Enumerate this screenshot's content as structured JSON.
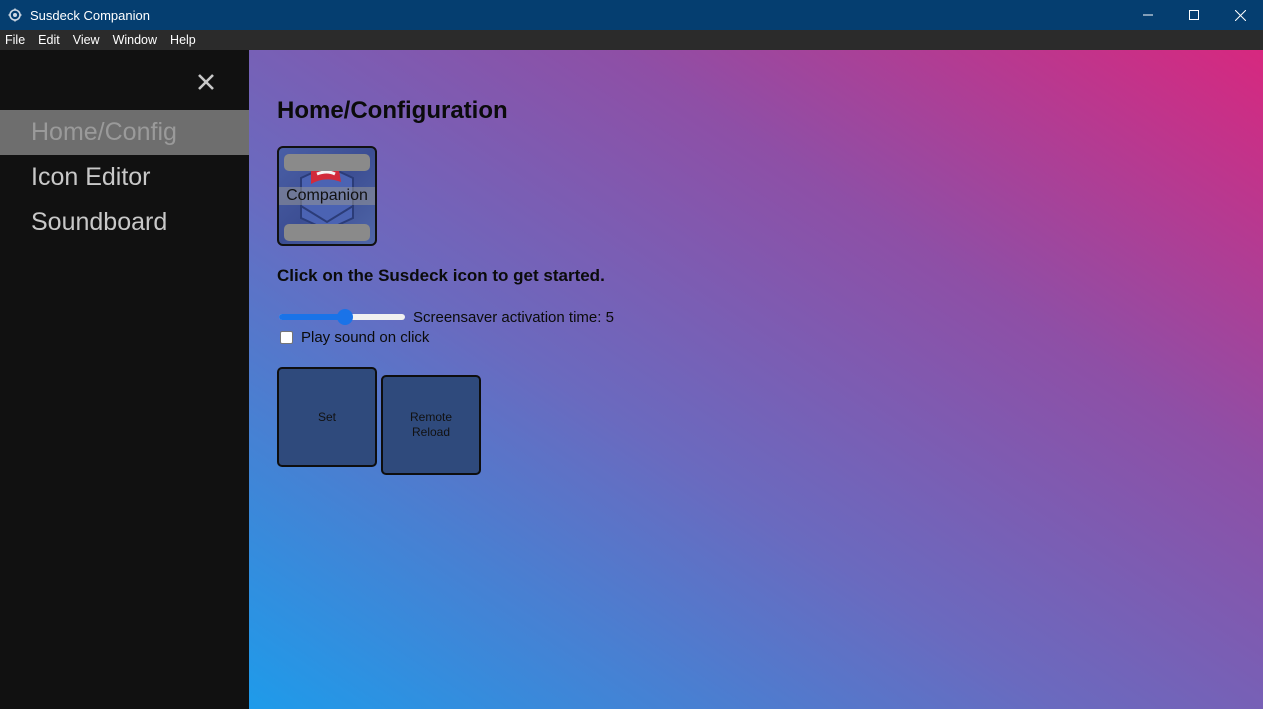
{
  "window": {
    "title": "Susdeck Companion",
    "controls": {
      "minimize": "—",
      "maximize": "☐",
      "close": "✕"
    }
  },
  "menu": [
    "File",
    "Edit",
    "View",
    "Window",
    "Help"
  ],
  "sidebar": {
    "close_symbol": "✕",
    "items": [
      {
        "label": "Home/Config",
        "active": true
      },
      {
        "label": "Icon Editor",
        "active": false
      },
      {
        "label": "Soundboard",
        "active": false
      }
    ]
  },
  "main": {
    "title": "Home/Configuration",
    "logo_label": "Companion",
    "intro": "Click on the Susdeck icon to get started.",
    "screensaver": {
      "label": "Screensaver activation time: 5",
      "value": 5,
      "fraction": 0.52
    },
    "play_sound": {
      "label": "Play sound on click",
      "checked": false
    },
    "buttons": {
      "set": "Set",
      "reload": "Remote Reload"
    }
  },
  "colors": {
    "titlebar": "#053e70",
    "menubar": "#2b2b2b",
    "sidebar": "#111111",
    "gradient_start": "#1e9bea",
    "gradient_end": "#d7287f",
    "button": "#2f4a7c",
    "accent": "#1a73e8"
  }
}
